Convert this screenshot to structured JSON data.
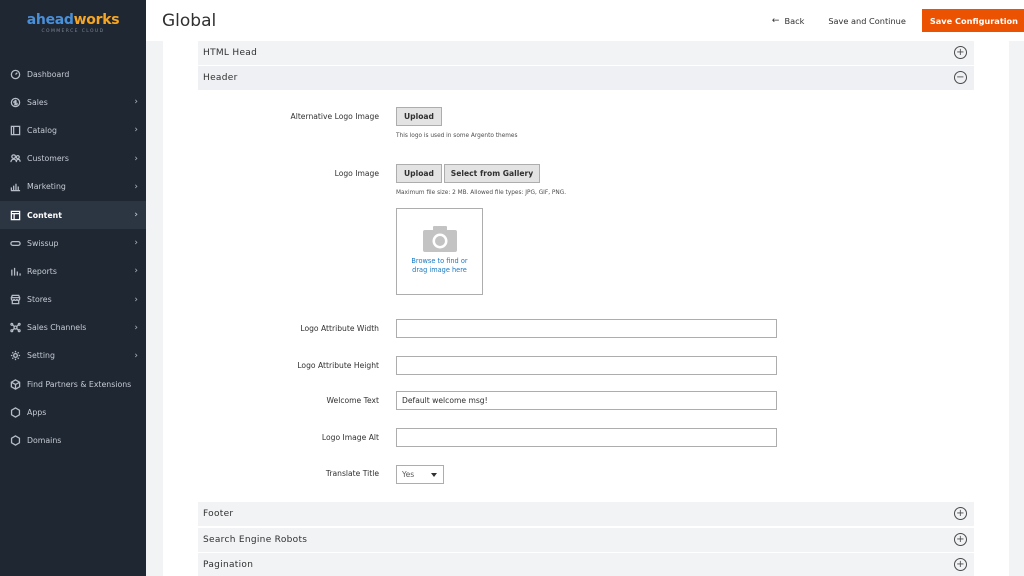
{
  "brand": {
    "name_a": "ahead",
    "name_b": "works",
    "tagline": "COMMERCE CLOUD"
  },
  "sidebar": {
    "items": [
      {
        "label": "Dashboard",
        "icon": "dashboard-icon",
        "chevron": false
      },
      {
        "label": "Sales",
        "icon": "dollar-icon",
        "chevron": true
      },
      {
        "label": "Catalog",
        "icon": "catalog-icon",
        "chevron": true
      },
      {
        "label": "Customers",
        "icon": "customers-icon",
        "chevron": true
      },
      {
        "label": "Marketing",
        "icon": "marketing-icon",
        "chevron": true
      },
      {
        "label": "Content",
        "icon": "content-icon",
        "chevron": true,
        "active": true
      },
      {
        "label": "Swissup",
        "icon": "swissup-icon",
        "chevron": true
      },
      {
        "label": "Reports",
        "icon": "reports-icon",
        "chevron": true
      },
      {
        "label": "Stores",
        "icon": "stores-icon",
        "chevron": true
      },
      {
        "label": "Sales Channels",
        "icon": "sales-channels-icon",
        "chevron": true
      },
      {
        "label": "Setting",
        "icon": "gear-icon",
        "chevron": true
      },
      {
        "label": "Find Partners & Extensions",
        "icon": "extensions-icon",
        "chevron": false
      },
      {
        "label": "Apps",
        "icon": "hexagon-icon",
        "chevron": false
      },
      {
        "label": "Domains",
        "icon": "hexagon-icon",
        "chevron": false
      }
    ]
  },
  "header": {
    "title": "Global",
    "back_label": "Back",
    "save_continue_label": "Save and Continue",
    "save_config_label": "Save Configuration"
  },
  "sections": {
    "html_head": "HTML Head",
    "header": "Header",
    "footer": "Footer",
    "robots": "Search Engine Robots",
    "pagination": "Pagination"
  },
  "form": {
    "alt_logo_label": "Alternative Logo Image",
    "upload_label": "Upload",
    "alt_logo_note": "This logo is used in some Argento themes",
    "logo_label": "Logo Image",
    "gallery_label": "Select from Gallery",
    "logo_note": "Maximum file size: 2 MB. Allowed file types: JPG, GIF, PNG.",
    "uploader_text_1": "Browse to find or",
    "uploader_text_2": "drag image here",
    "width_label": "Logo Attribute Width",
    "width_value": "",
    "height_label": "Logo Attribute Height",
    "height_value": "",
    "welcome_label": "Welcome Text",
    "welcome_value": "Default welcome msg!",
    "alt_label": "Logo Image Alt",
    "alt_value": "",
    "translate_label": "Translate Title",
    "translate_value": "Yes"
  },
  "colors": {
    "accent": "#eb5202",
    "sidebar_bg": "#1f2733",
    "link": "#1979c3"
  }
}
